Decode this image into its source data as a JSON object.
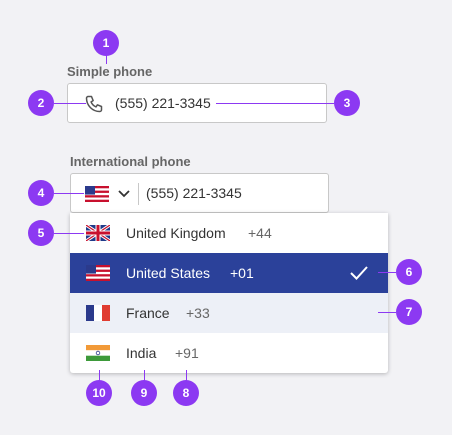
{
  "simple": {
    "label": "Simple phone",
    "value": "(555) 221-3345",
    "icon": "phone-icon"
  },
  "international": {
    "label": "International phone",
    "value": "(555) 221-3345",
    "selected_flag": "us-flag-icon"
  },
  "countries": [
    {
      "name": "United Kingdom",
      "code": "+44",
      "flag": "uk-flag-icon"
    },
    {
      "name": "United States",
      "code": "+01",
      "flag": "us-flag-icon",
      "selected": true
    },
    {
      "name": "France",
      "code": "+33",
      "flag": "france-flag-icon",
      "hover": true
    },
    {
      "name": "India",
      "code": "+91",
      "flag": "india-flag-icon"
    }
  ],
  "badges": [
    "1",
    "2",
    "3",
    "4",
    "5",
    "6",
    "7",
    "8",
    "9",
    "10"
  ],
  "colors": {
    "accent": "#8c39f2",
    "selected_bg": "#2b419a",
    "hover_bg": "#edf0f7"
  }
}
